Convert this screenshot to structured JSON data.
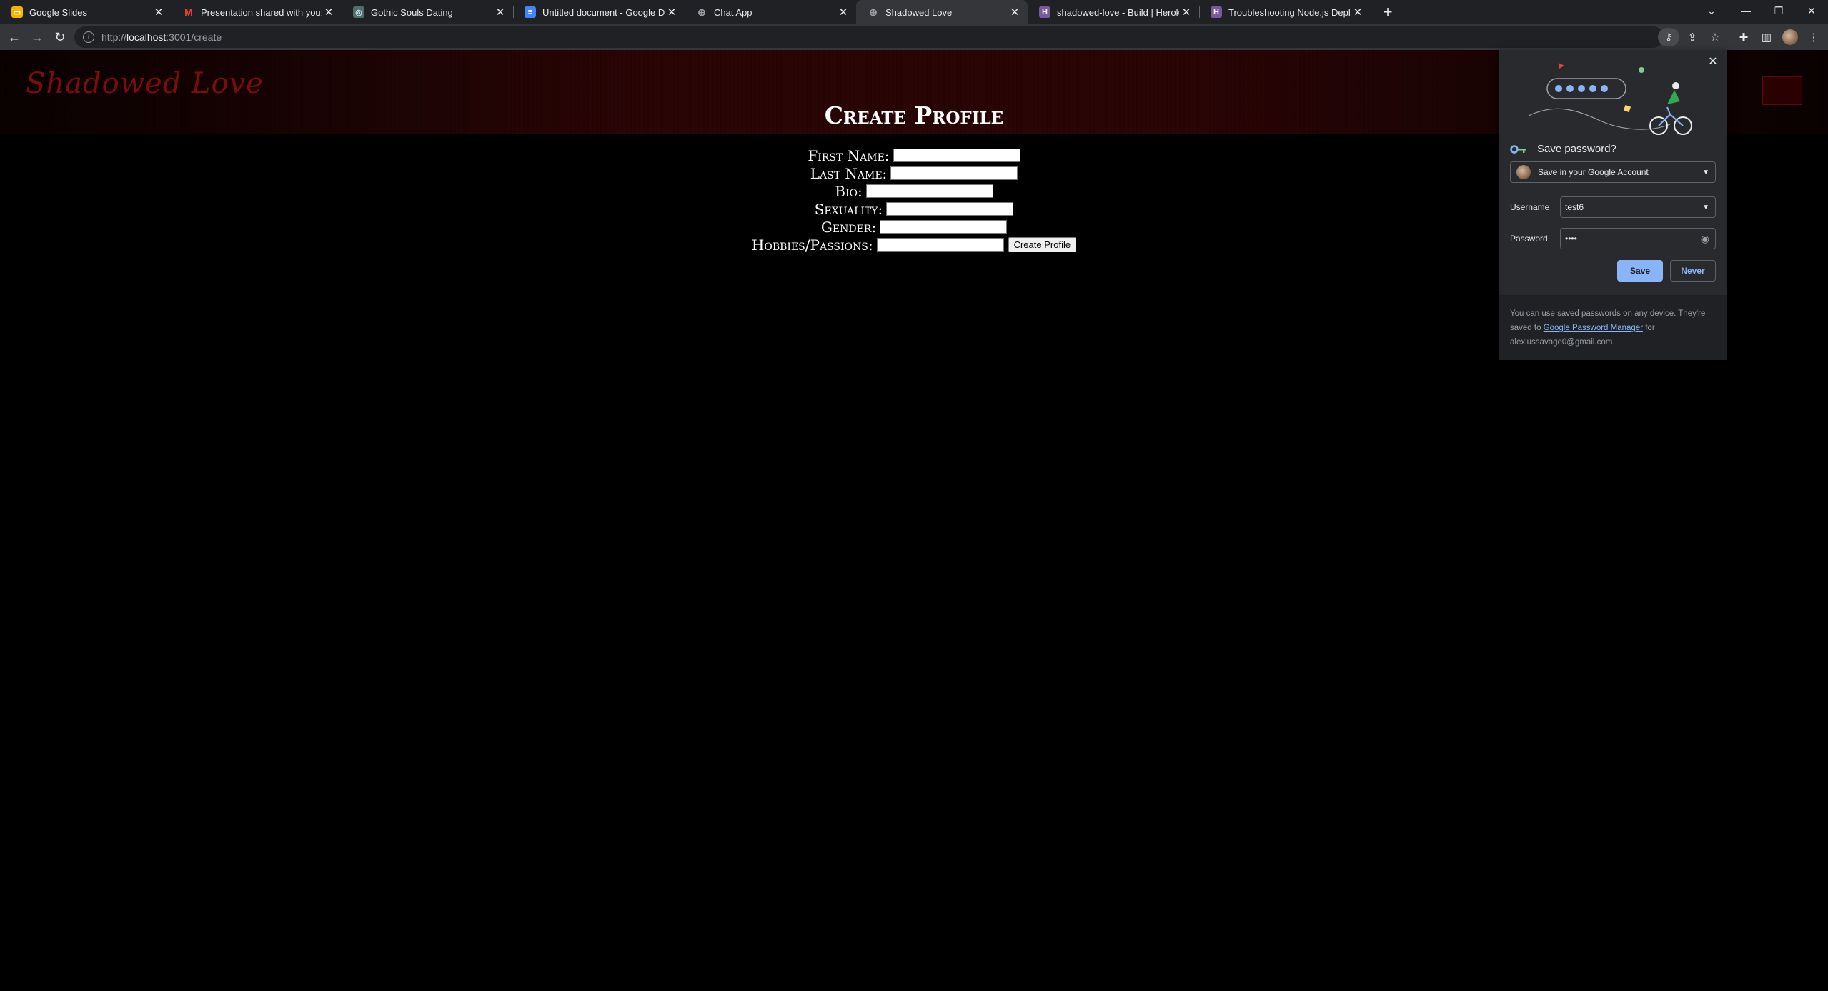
{
  "browser": {
    "tabs": [
      {
        "title": "Google Slides",
        "favicon": "slides-icon"
      },
      {
        "title": "Presentation shared with you: \"Sh",
        "favicon": "gmail-icon"
      },
      {
        "title": "Gothic Souls Dating",
        "favicon": "globe-icon"
      },
      {
        "title": "Untitled document - Google Doc",
        "favicon": "docs-icon"
      },
      {
        "title": "Chat App",
        "favicon": "globe-icon"
      },
      {
        "title": "Shadowed Love",
        "favicon": "globe-icon"
      },
      {
        "title": "shadowed-love - Build | Heroku",
        "favicon": "heroku-icon"
      },
      {
        "title": "Troubleshooting Node.js Deploy",
        "favicon": "heroku-icon"
      }
    ],
    "active_tab": 5,
    "url_prefix": "http://",
    "url_host": "localhost",
    "url_rest": ":3001/create"
  },
  "site": {
    "logo": "Shadowed Love",
    "page_title": "Create Profile",
    "fields": [
      {
        "label": "First Name:"
      },
      {
        "label": "Last Name:"
      },
      {
        "label": "Bio:"
      },
      {
        "label": "Sexuality:"
      },
      {
        "label": "Gender:"
      },
      {
        "label": "Hobbies/Passions:"
      }
    ],
    "submit_label": "Create Profile"
  },
  "password_popup": {
    "title": "Save password?",
    "account_option": "Save in your Google Account",
    "username_label": "Username",
    "username_value": "test6",
    "password_label": "Password",
    "password_value": "••••",
    "save_label": "Save",
    "never_label": "Never",
    "footer_text_1": "You can use saved passwords on any device. They're saved to ",
    "footer_link": "Google Password Manager",
    "footer_text_2": " for alexiussavage0@gmail.com."
  },
  "colors": {
    "accent_blue": "#8ab4f8",
    "logo_red": "#7a0d0d",
    "header_dark_red": "#2a0505"
  }
}
